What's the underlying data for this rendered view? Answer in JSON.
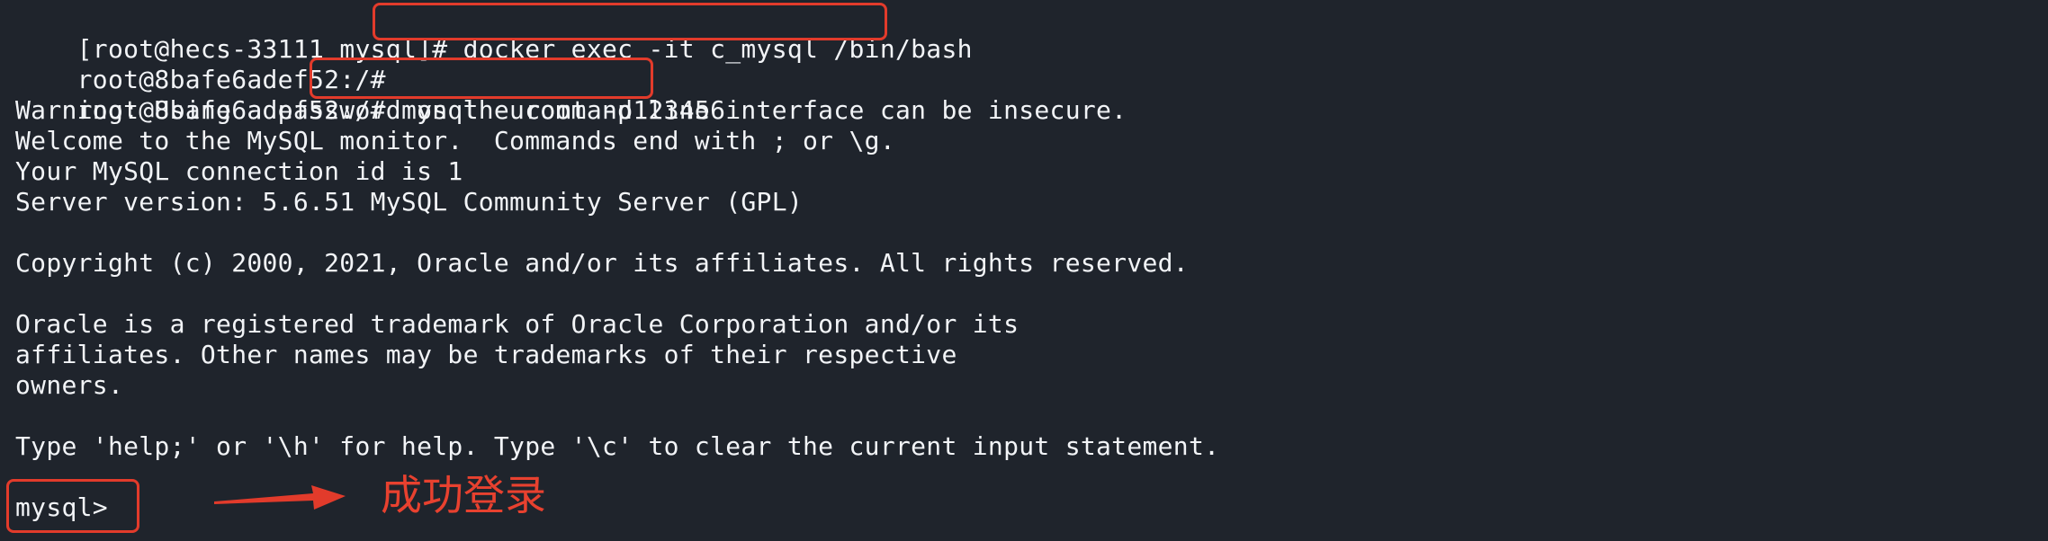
{
  "terminal": {
    "lines": [
      {
        "prefix": "[root@hecs-33111 mysql]# ",
        "command": "docker exec -it c_mysql /bin/bash"
      },
      {
        "prefix": "root@8bafe6adef52:/#",
        "command": ""
      },
      {
        "prefix": "root@8bafe6adef52:/# ",
        "command": "mysql -uroot -p123456"
      },
      {
        "text": "Warning: Using a password on the command line interface can be insecure."
      },
      {
        "text": "Welcome to the MySQL monitor.  Commands end with ; or \\g."
      },
      {
        "text": "Your MySQL connection id is 1"
      },
      {
        "text": "Server version: 5.6.51 MySQL Community Server (GPL)"
      },
      {
        "text": ""
      },
      {
        "text": "Copyright (c) 2000, 2021, Oracle and/or its affiliates. All rights reserved."
      },
      {
        "text": ""
      },
      {
        "text": "Oracle is a registered trademark of Oracle Corporation and/or its"
      },
      {
        "text": "affiliates. Other names may be trademarks of their respective"
      },
      {
        "text": "owners."
      },
      {
        "text": ""
      },
      {
        "text": "Type 'help;' or '\\h' for help. Type '\\c' to clear the current input statement."
      },
      {
        "text": ""
      },
      {
        "text": "mysql>"
      }
    ]
  },
  "annotation": {
    "label": "成功登录",
    "color": "#e8412f"
  },
  "colors": {
    "background": "#1f242c",
    "text": "#f2f4f7",
    "highlight": "#e23b2b"
  }
}
